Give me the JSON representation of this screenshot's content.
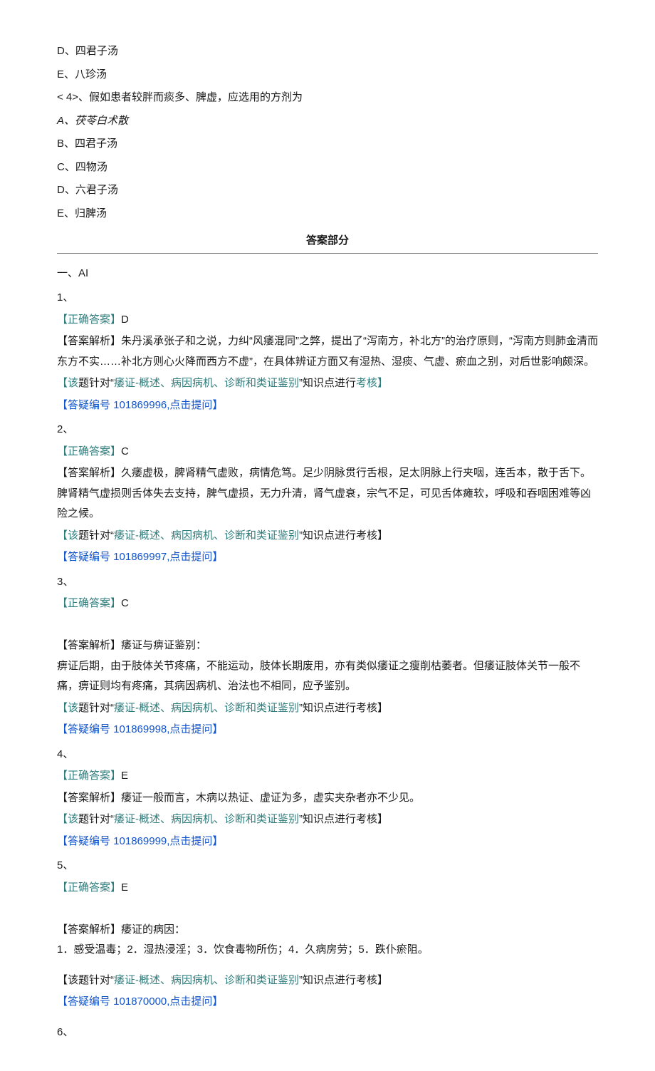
{
  "options_top": [
    "D、四君子汤",
    "E、八珍汤"
  ],
  "sub_question": "< 4>、假如患者较胖而痰多、脾虚，应选用的方剂为",
  "options_sub": [
    "A、茯苓白术散",
    "B、四君子汤",
    "C、四物汤",
    "D、六君子汤",
    "E、归脾汤"
  ],
  "answer_section_title": "答案部分",
  "section_header": "一、AI",
  "answers": [
    {
      "num": "1、",
      "correct_label": "【正确答案】",
      "correct_value": "D",
      "expl_label": "【答案解析】",
      "expl_text": "朱丹溪承张子和之说，力纠“风痿混同”之弊，提出了“泻南方，补北方”的治疗原则，“泻南方则肺金清而东方不实……补北方则心火降而西方不虚”，在具体辨证方面又有湿热、湿痰、气虚、瘀血之别，对后世影响颇深。",
      "tag_pre": "【该",
      "tag_mid1": "题针对“",
      "tag_topic": "痿证-概述、病因病机、诊断和类证鉴别",
      "tag_mid2": "”知识点进行",
      "tag_end": "考核】",
      "link": "【答疑编号 101869996,点击提问】"
    },
    {
      "num": "2、",
      "correct_label": "【正确答案】",
      "correct_value": "C",
      "expl_label": "【答案解析】",
      "expl_text": "久痿虚极，脾肾精气虚败，病情危笃。足少阴脉贯行舌根，足太阴脉上行夹咽，连舌本，散于舌下。脾肾精气虚损则舌体失去支持，脾气虚损，无力升清，肾气虚衰，宗气不足，可见舌体瘫软，呼吸和吞咽困难等凶险之候。",
      "tag_pre": "【该",
      "tag_mid1": "题针对“",
      "tag_topic": "痿证-概述、病因病机、诊断和类证鉴别",
      "tag_mid2": "”",
      "tag_end": "知识点进行考核】",
      "link": "【答疑编号 101869997,点击提问】"
    },
    {
      "num": "3、",
      "correct_label": "【正确答案】",
      "correct_value": "C",
      "expl_label": "【答案解析】",
      "expl_text": "痿证与痹证鉴别：\n痹证后期，由于肢体关节疼痛，不能运动，肢体长期废用，亦有类似痿证之瘦削枯萎者。但痿证肢体关节一般不痛，痹证则均有疼痛，其病因病机、治法也不相同，应予鉴别。",
      "tag_pre": "【该",
      "tag_mid1": "题针对“",
      "tag_topic": "痿证-概述、病因病机、诊断和类证鉴别",
      "tag_mid2": "”",
      "tag_end": "知识点进行考核】",
      "link": "【答疑编号 101869998,点击提问】"
    },
    {
      "num": "4、",
      "correct_label": "【正确答案】",
      "correct_value": "E",
      "expl_label": "【答案解析】",
      "expl_text": "痿证一般而言，木病以热证、虚证为多，虚实夹杂者亦不少见。",
      "tag_pre": "【该",
      "tag_mid1": "题针对“",
      "tag_topic": "痿证-概述、病因病机、诊断和类证鉴别",
      "tag_mid2": "”",
      "tag_end": "知识点进行考核】",
      "link": "【答疑编号 101869999,点击提问】"
    },
    {
      "num": "5、",
      "correct_label": "【正确答案】",
      "correct_value": "E",
      "expl_label": "【答案解析】",
      "expl_text": "痿证的病因：\n1．感受温毒；2．湿热浸淫；3．饮食毒物所伤；4．久病房劳；5．跌仆瘀阻。",
      "tag_pre": "",
      "tag_mid1": "【该题针对“",
      "tag_topic": "痿证-概述、病因病机、诊断和类证鉴别",
      "tag_mid2": "”知识点进行考核】",
      "tag_end": "",
      "link": "【答疑编号 101870000,点击提问】",
      "extra_gap": true
    }
  ],
  "trailing_num": "6、"
}
